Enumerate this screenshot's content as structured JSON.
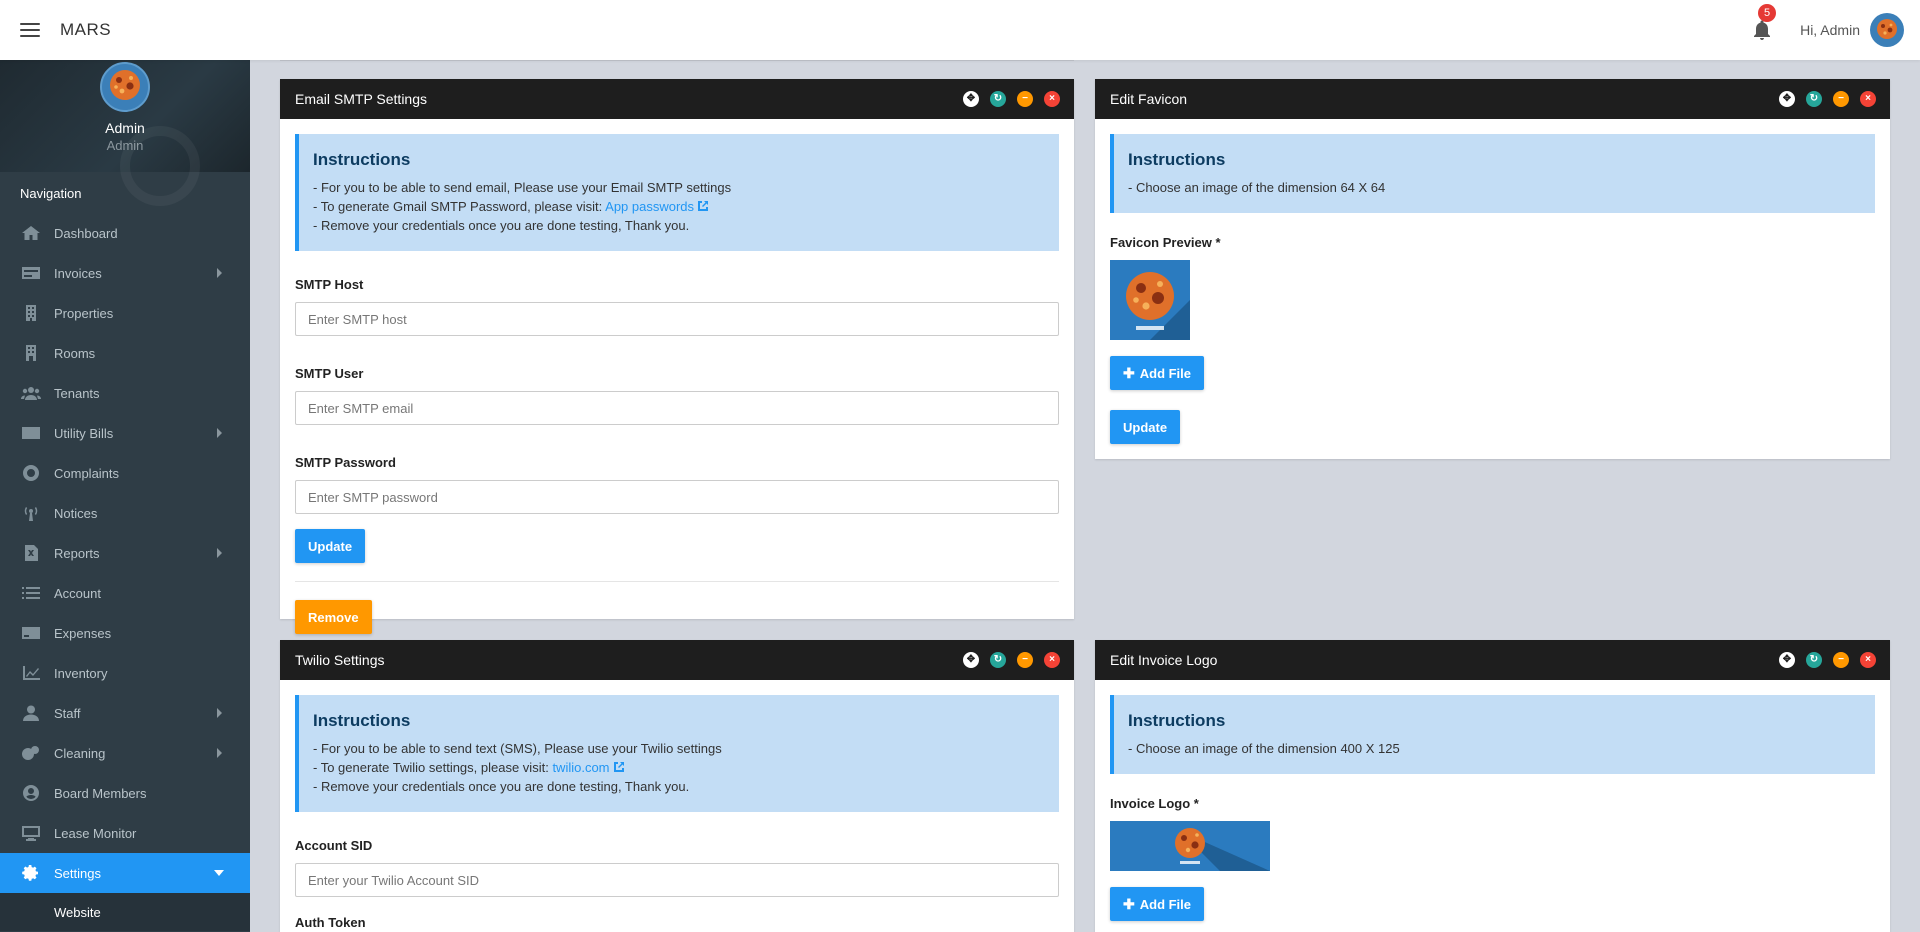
{
  "app": {
    "brand": "MARS",
    "notification_count": "5",
    "greeting": "Hi, Admin"
  },
  "profile": {
    "name": "Admin",
    "role": "Admin"
  },
  "nav": {
    "heading": "Navigation",
    "items": [
      {
        "label": "Dashboard",
        "icon": "home-icon"
      },
      {
        "label": "Invoices",
        "icon": "invoice-icon"
      },
      {
        "label": "Properties",
        "icon": "building-icon"
      },
      {
        "label": "Rooms",
        "icon": "door-icon"
      },
      {
        "label": "Tenants",
        "icon": "users-icon"
      },
      {
        "label": "Utility Bills",
        "icon": "bill-icon"
      },
      {
        "label": "Complaints",
        "icon": "lifebuoy-icon"
      },
      {
        "label": "Notices",
        "icon": "broadcast-icon"
      },
      {
        "label": "Reports",
        "icon": "report-icon"
      },
      {
        "label": "Account",
        "icon": "list-icon"
      },
      {
        "label": "Expenses",
        "icon": "card-icon"
      },
      {
        "label": "Inventory",
        "icon": "chart-icon"
      },
      {
        "label": "Staff",
        "icon": "user-icon"
      },
      {
        "label": "Cleaning",
        "icon": "cleaning-icon"
      },
      {
        "label": "Board Members",
        "icon": "member-icon"
      },
      {
        "label": "Lease Monitor",
        "icon": "monitor-icon"
      },
      {
        "label": "Settings",
        "icon": "gear-icon"
      }
    ],
    "sub_items": [
      {
        "label": "Website"
      }
    ]
  },
  "email_card": {
    "title": "Email SMTP Settings",
    "instructions": {
      "title": "Instructions",
      "line1": "- For you to be able to send email, Please use your Email SMTP settings",
      "line2_prefix": "- To generate Gmail SMTP Password, please visit:",
      "line2_link": "App passwords",
      "line3": "- Remove your credentials once you are done testing, Thank you."
    },
    "host_label": "SMTP Host",
    "host_placeholder": "Enter SMTP host",
    "user_label": "SMTP User",
    "user_placeholder": "Enter SMTP email",
    "password_label": "SMTP Password",
    "password_placeholder": "Enter SMTP password",
    "update_label": "Update",
    "remove_label": "Remove"
  },
  "favicon_card": {
    "title": "Edit Favicon",
    "instructions": {
      "title": "Instructions",
      "line1": "- Choose an image of the dimension 64 X 64"
    },
    "preview_label": "Favicon Preview *",
    "add_file_label": "Add File",
    "update_label": "Update"
  },
  "twilio_card": {
    "title": "Twilio Settings",
    "instructions": {
      "title": "Instructions",
      "line1": "- For you to be able to send text (SMS), Please use your Twilio settings",
      "line2_prefix": "- To generate Twilio settings, please visit:",
      "line2_link": "twilio.com",
      "line3": "- Remove your credentials once you are done testing, Thank you."
    },
    "sid_label": "Account SID",
    "sid_placeholder": "Enter your Twilio Account SID",
    "token_label": "Auth Token"
  },
  "invoice_card": {
    "title": "Edit Invoice Logo",
    "instructions": {
      "title": "Instructions",
      "line1": "- Choose an image of the dimension 400 X 125"
    },
    "logo_label": "Invoice Logo *",
    "add_file_label": "Add File"
  },
  "colors": {
    "accent": "#2196f3",
    "warning": "#ff9800",
    "danger": "#f44336",
    "success": "#26a69a",
    "sidebar": "#2f3d46"
  }
}
